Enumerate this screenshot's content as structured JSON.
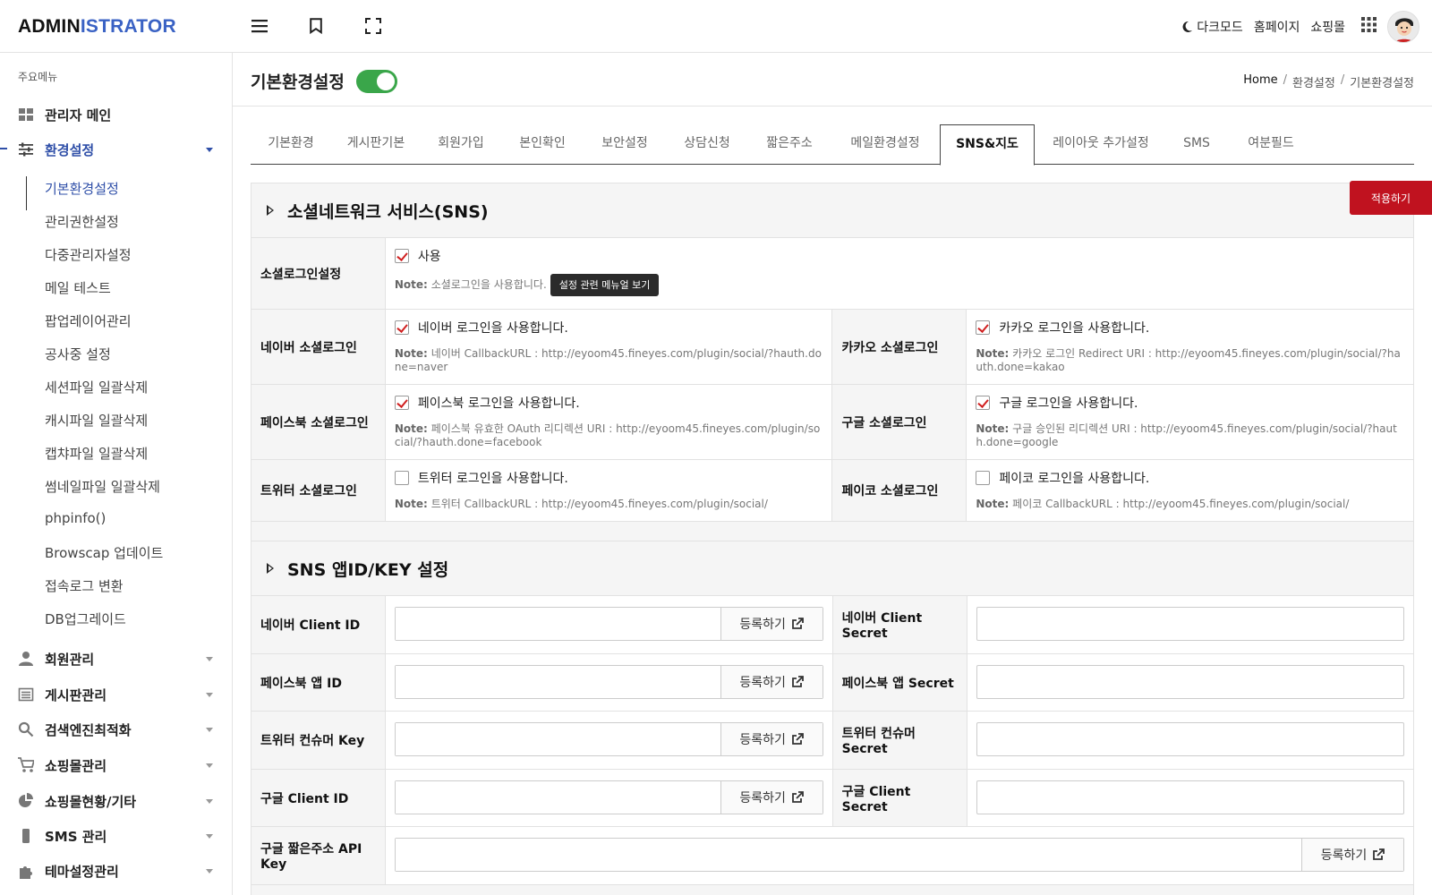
{
  "app": {
    "logo_part1": "ADMIN",
    "logo_part2": "ISTRATOR",
    "brand_color": "#3a62c4"
  },
  "header": {
    "menu_icon": "hamburger-icon",
    "bookmark_icon": "bookmark-icon",
    "fullscreen_icon": "fullscreen-icon",
    "dark_mode": "다크모드",
    "homepage": "홈페이지",
    "shop": "쇼핑몰",
    "apps_icon": "grid-icon"
  },
  "sidebar": {
    "caption": "주요메뉴",
    "items": [
      {
        "label": "관리자 메인",
        "icon": "dashboard-icon"
      },
      {
        "label": "환경설정",
        "icon": "sliders-icon"
      },
      {
        "label": "회원관리",
        "icon": "user-icon"
      },
      {
        "label": "게시판관리",
        "icon": "list-icon"
      },
      {
        "label": "검색엔진최적화",
        "icon": "search-icon"
      },
      {
        "label": "쇼핑몰관리",
        "icon": "cart-icon"
      },
      {
        "label": "쇼핑몰현황/기타",
        "icon": "pie-icon"
      },
      {
        "label": "SMS 관리",
        "icon": "phone-icon"
      },
      {
        "label": "테마설정관리",
        "icon": "puzzle-icon"
      }
    ],
    "sub_items": [
      "기본환경설정",
      "관리권한설정",
      "다중관리자설정",
      "메일 테스트",
      "팝업레이어관리",
      "공사중 설정",
      "세션파일 일괄삭제",
      "캐시파일 일괄삭제",
      "캡챠파일 일괄삭제",
      "썸네일파일 일괄삭제",
      "phpinfo()",
      "Browscap 업데이트",
      "접속로그 변환",
      "DB업그레이드"
    ],
    "active_color": "#2f4fa8"
  },
  "page": {
    "title": "기본환경설정",
    "toggle_on": true,
    "toggle_color": "#3aa64a",
    "breadcrumb": [
      "Home",
      "환경설정",
      "기본환경설정"
    ],
    "apply_button": "적용하기",
    "apply_color": "#c0121f"
  },
  "tabs": [
    "기본환경",
    "게시판기본",
    "회원가입",
    "본인확인",
    "보안설정",
    "상담신청",
    "짧은주소",
    "메일환경설정",
    "SNS&지도",
    "레이아웃 추가설정",
    "SMS",
    "여분필드"
  ],
  "active_tab": "SNS&지도",
  "sns_section": {
    "title": "소셜네트워크 서비스(SNS)",
    "social_login": {
      "label": "소셜로그인설정",
      "checkbox": "사용",
      "checked": true,
      "note_prefix": "Note:",
      "note": "소셜로그인을 사용합니다.",
      "tooltip": "설정 관련 메뉴얼 보기"
    },
    "naver": {
      "label": "네이버 소셜로그인",
      "checkbox": "네이버 로그인을 사용합니다.",
      "checked": true,
      "note": "네이버 CallbackURL : http://eyoom45.fineyes.com/plugin/social/?hauth.done=naver"
    },
    "kakao": {
      "label": "카카오 소셜로그인",
      "checkbox": "카카오 로그인을 사용합니다.",
      "checked": true,
      "note": "카카오 로그인 Redirect URI : http://eyoom45.fineyes.com/plugin/social/?hauth.done=kakao"
    },
    "facebook": {
      "label": "페이스북 소셜로그인",
      "checkbox": "페이스북 로그인을 사용합니다.",
      "checked": true,
      "note": "페이스북 유효한 OAuth 리디렉션 URI : http://eyoom45.fineyes.com/plugin/social/?hauth.done=facebook"
    },
    "google": {
      "label": "구글 소셜로그인",
      "checkbox": "구글 로그인을 사용합니다.",
      "checked": true,
      "note": "구글 승인된 리디렉션 URI : http://eyoom45.fineyes.com/plugin/social/?hauth.done=google"
    },
    "twitter": {
      "label": "트위터 소셜로그인",
      "checkbox": "트위터 로그인을 사용합니다.",
      "checked": false,
      "note": "트위터 CallbackURL : http://eyoom45.fineyes.com/plugin/social/"
    },
    "payco": {
      "label": "페이코 소셜로그인",
      "checkbox": "페이코 로그인을 사용합니다.",
      "checked": false,
      "note": "페이코 CallbackURL : http://eyoom45.fineyes.com/plugin/social/"
    }
  },
  "key_section": {
    "title": "SNS 앱ID/KEY 설정",
    "register_label": "등록하기",
    "rows": [
      {
        "left_label": "네이버 Client ID",
        "left_value": "",
        "right_label": "네이버 Client Secret",
        "right_value": ""
      },
      {
        "left_label": "페이스북 앱 ID",
        "left_value": "",
        "right_label": "페이스북 앱 Secret",
        "right_value": ""
      },
      {
        "left_label": "트위터 컨슈머 Key",
        "left_value": "",
        "right_label": "트위터 컨슈머 Secret",
        "right_value": ""
      },
      {
        "left_label": "구글 Client ID",
        "left_value": "",
        "right_label": "구글 Client Secret",
        "right_value": ""
      }
    ],
    "google_short": {
      "label": "구글 짧은주소 API Key",
      "value": ""
    }
  }
}
